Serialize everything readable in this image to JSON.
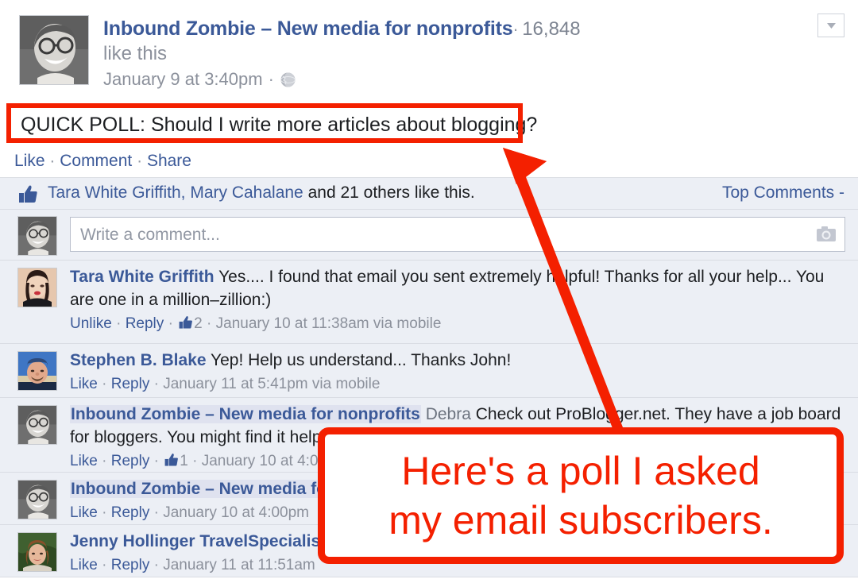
{
  "post": {
    "page_name": "Inbound Zombie – New media for nonprofits",
    "separator": "·",
    "like_count": "16,848",
    "like_this_label": "like this",
    "timestamp": "January 9 at 3:40pm",
    "privacy_icon": "globe-icon",
    "caret_icon": "chevron-down-icon",
    "message": "QUICK POLL: Should I write more articles about blogging?"
  },
  "actions": {
    "like": "Like",
    "comment": "Comment",
    "share": "Share",
    "separator": "·"
  },
  "likes": {
    "thumb_icon": "thumbs-up-icon",
    "names": "Tara White Griffith, Mary Cahalane",
    "suffix": " and 21 others like this.",
    "sort_label": "Top Comments -"
  },
  "composer": {
    "placeholder": "Write a comment...",
    "camera_icon": "camera-icon"
  },
  "comments": [
    {
      "author": "Tara White Griffith",
      "author_highlighted": false,
      "tagged": "",
      "text": " Yes.... I found that email you sent extremely helpful! Thanks for all your help... You are one in a million–zillion:)",
      "like_action": "Unlike",
      "reply_action": "Reply",
      "like_count": "2",
      "meta_time": "January 10 at 11:38am via mobile"
    },
    {
      "author": "Stephen B. Blake",
      "author_highlighted": false,
      "tagged": "",
      "text": " Yep! Help us understand... Thanks John!",
      "like_action": "Like",
      "reply_action": "Reply",
      "like_count": "",
      "meta_time": "January 11 at 5:41pm via mobile"
    },
    {
      "author": "Inbound Zombie – New media for nonprofits",
      "author_highlighted": true,
      "tagged": "Debra",
      "text": " Check out ProBlogger.net. They have a job board for bloggers. You might find it helpful.",
      "like_action": "Like",
      "reply_action": "Reply",
      "like_count": "1",
      "meta_time": "January 10 at 4:0"
    },
    {
      "author": "Inbound Zombie – New media fo",
      "author_highlighted": true,
      "tagged": "",
      "text": "",
      "like_action": "Like",
      "reply_action": "Reply",
      "like_count": "",
      "meta_time": "January 10 at 4:00pm"
    },
    {
      "author": "Jenny Hollinger TravelSpecialist",
      "author_highlighted": false,
      "tagged": "",
      "text": "",
      "like_action": "Like",
      "reply_action": "Reply",
      "like_count": "",
      "meta_time": "January 11 at 11:51am"
    }
  ],
  "annotation": {
    "callout_line1": "Here's a poll I asked",
    "callout_line2": "my email subscribers.",
    "arrow_icon": "arrow-up-left-icon",
    "highlight_icon": "red-highlight-box",
    "accent_color": "#f42000"
  },
  "colors": {
    "facebook_blue": "#3b5998",
    "comment_background": "#eceff5",
    "annotation_red": "#f42000"
  }
}
